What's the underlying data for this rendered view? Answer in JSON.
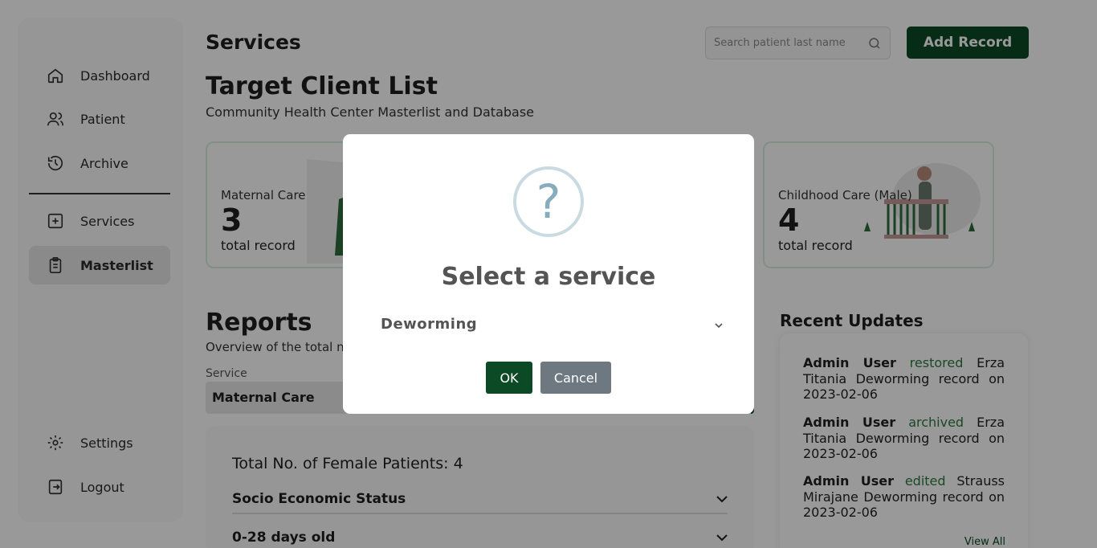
{
  "sidebar": {
    "items": [
      {
        "label": "Dashboard",
        "icon": "home-icon"
      },
      {
        "label": "Patient",
        "icon": "users-icon"
      },
      {
        "label": "Archive",
        "icon": "history-icon"
      },
      {
        "label": "Services",
        "icon": "medical-icon"
      },
      {
        "label": "Masterlist",
        "icon": "clipboard-icon",
        "active": true
      }
    ],
    "bottom": [
      {
        "label": "Settings",
        "icon": "gear-icon"
      },
      {
        "label": "Logout",
        "icon": "logout-icon"
      }
    ]
  },
  "header": {
    "title": "Services",
    "search_placeholder": "Search patient last name",
    "add_label": "Add Record"
  },
  "target": {
    "title": "Target Client List",
    "subtitle": "Community Health Center Masterlist and Database"
  },
  "cards": [
    {
      "label": "Maternal Care",
      "value": "3",
      "unit": "total record"
    },
    {
      "label": "Childhood Care (Male)",
      "value": "4",
      "unit": "total record"
    }
  ],
  "reports": {
    "title": "Reports",
    "subtitle": "Overview of the total n",
    "service_label": "Service",
    "service_value": "Maternal Care",
    "total_label": "Total No. of Female Patients: 4",
    "sections": [
      "Socio Economic Status",
      "0-28 days old"
    ]
  },
  "updates": {
    "title": "Recent Updates",
    "items": [
      {
        "who": "Admin User",
        "action": "restored",
        "rest": "Erza Titania Deworming record on 2023-02-06"
      },
      {
        "who": "Admin User",
        "action": "archived",
        "rest": "Erza Titania Deworming record on 2023-02-06"
      },
      {
        "who": "Admin User",
        "action": "edited",
        "rest": "Strauss Mirajane Deworming record on 2023-02-06"
      }
    ],
    "view_all": "View All"
  },
  "modal": {
    "icon_glyph": "?",
    "title": "Select a service",
    "selected": "Deworming",
    "ok": "OK",
    "cancel": "Cancel"
  },
  "colors": {
    "accent": "#0b4a25",
    "action_text": "#2a7a3f"
  }
}
